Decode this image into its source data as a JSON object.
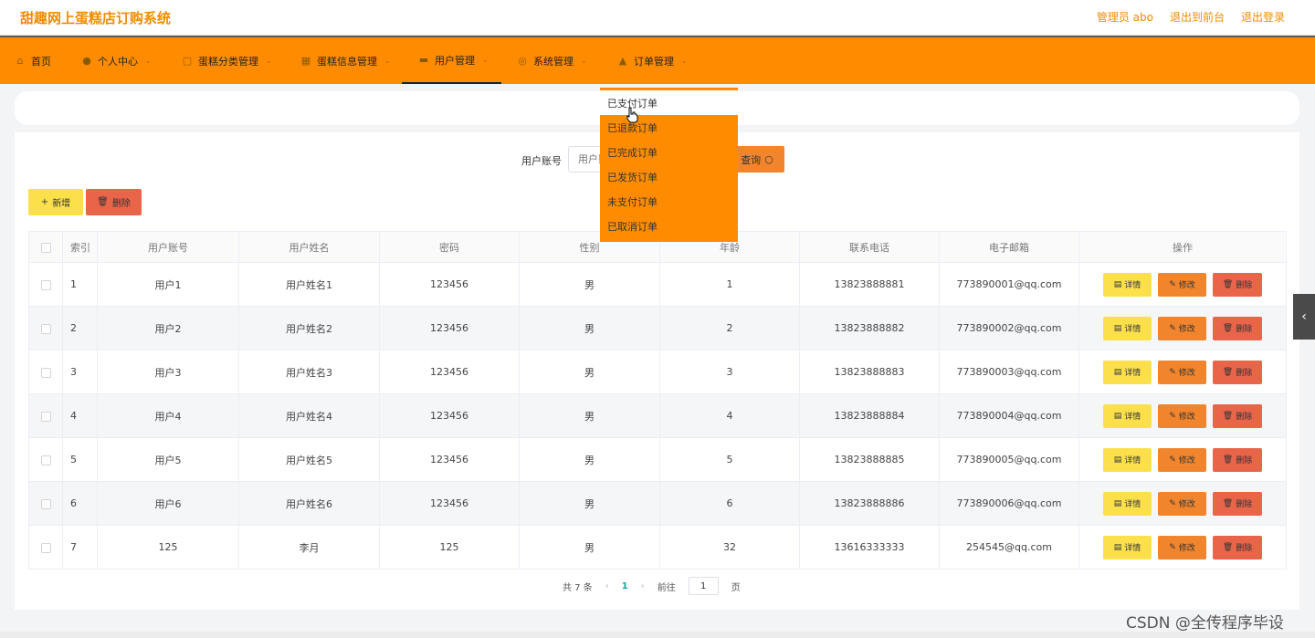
{
  "header": {
    "title": "甜趣网上蛋糕店订购系统",
    "admin": "管理员 abo",
    "to_front": "退出到前台",
    "logout": "退出登录"
  },
  "nav": {
    "home": "首页",
    "personal": "个人中心",
    "cake_category": "蛋糕分类管理",
    "cake_info": "蛋糕信息管理",
    "user": "用户管理",
    "system": "系统管理",
    "order": "订单管理"
  },
  "dropdown": {
    "items": [
      "已支付订单",
      "已退款订单",
      "已完成订单",
      "已发货订单",
      "未支付订单",
      "已取消订单"
    ]
  },
  "search": {
    "label": "用户账号",
    "placeholder": "用户账号",
    "button": "查询"
  },
  "actions": {
    "add": "新增",
    "delete": "删除"
  },
  "table": {
    "headers": [
      "索引",
      "用户账号",
      "用户姓名",
      "密码",
      "性别",
      "年龄",
      "联系电话",
      "电子邮箱",
      "操作"
    ],
    "rows": [
      [
        "1",
        "用户1",
        "用户姓名1",
        "123456",
        "男",
        "1",
        "13823888881",
        "773890001@qq.com"
      ],
      [
        "2",
        "用户2",
        "用户姓名2",
        "123456",
        "男",
        "2",
        "13823888882",
        "773890002@qq.com"
      ],
      [
        "3",
        "用户3",
        "用户姓名3",
        "123456",
        "男",
        "3",
        "13823888883",
        "773890003@qq.com"
      ],
      [
        "4",
        "用户4",
        "用户姓名4",
        "123456",
        "男",
        "4",
        "13823888884",
        "773890004@qq.com"
      ],
      [
        "5",
        "用户5",
        "用户姓名5",
        "123456",
        "男",
        "5",
        "13823888885",
        "773890005@qq.com"
      ],
      [
        "6",
        "用户6",
        "用户姓名6",
        "123456",
        "男",
        "6",
        "13823888886",
        "773890006@qq.com"
      ],
      [
        "7",
        "125",
        "李月",
        "125",
        "男",
        "32",
        "13616333333",
        "254545@qq.com"
      ]
    ],
    "op_detail": "详情",
    "op_edit": "修改",
    "op_delete": "删除"
  },
  "pager": {
    "total": "共 7 条",
    "current": "1",
    "goto": "前往",
    "goto_value": "1",
    "page_unit": "页"
  },
  "watermark": "CSDN @全传程序毕设",
  "colors": {
    "accent": "#ff8c00",
    "yellow": "#fbe04c",
    "orange": "#f0852d",
    "red": "#e8654a"
  }
}
